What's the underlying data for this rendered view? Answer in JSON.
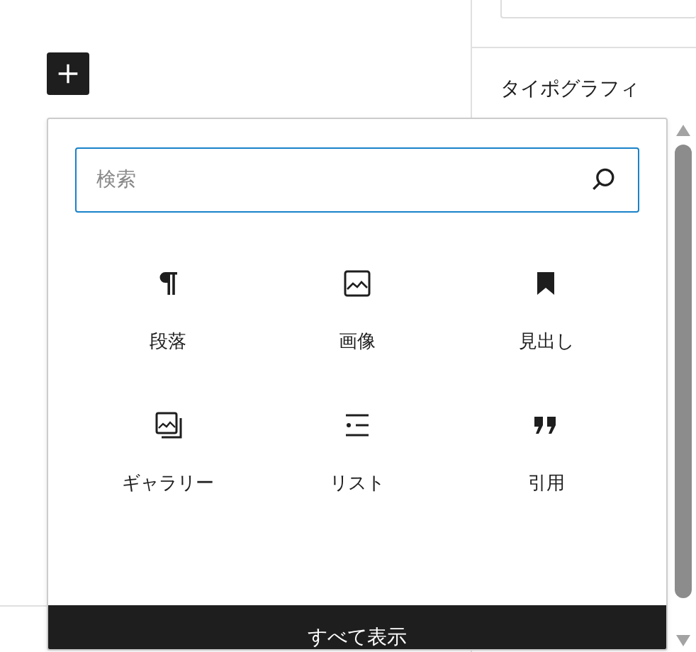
{
  "sidebar": {
    "heading": "タイポグラフィ"
  },
  "inserter": {
    "search": {
      "placeholder": "検索"
    },
    "blocks": [
      {
        "kind": "paragraph",
        "label": "段落"
      },
      {
        "kind": "image",
        "label": "画像"
      },
      {
        "kind": "heading",
        "label": "見出し"
      },
      {
        "kind": "gallery",
        "label": "ギャラリー"
      },
      {
        "kind": "list",
        "label": "リスト"
      },
      {
        "kind": "quote",
        "label": "引用"
      }
    ],
    "browse_all": "すべて表示"
  }
}
